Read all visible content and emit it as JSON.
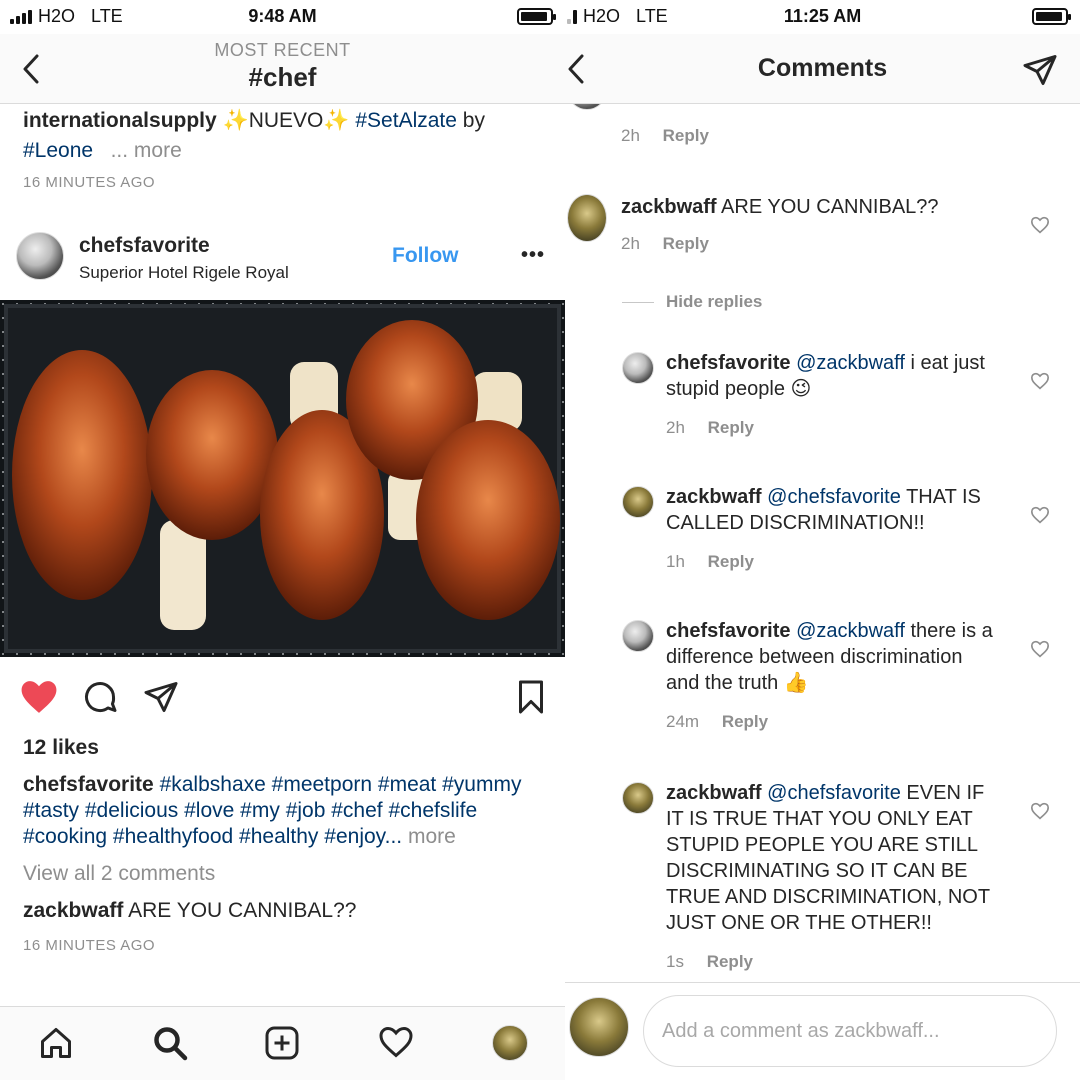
{
  "left": {
    "status": {
      "carrier": "H2O",
      "network": "LTE",
      "time": "9:48 AM"
    },
    "header": {
      "subtitle": "MOST RECENT",
      "title": "#chef"
    },
    "prev_post": {
      "username": "internationalsupply",
      "sparkle": "✨",
      "text1": "NUEVO",
      "tag1": "#SetAlzate",
      "by": "by",
      "tag2": "#Leone",
      "more": "... more",
      "time": "16 MINUTES AGO"
    },
    "post": {
      "username": "chefsfavorite",
      "location": "Superior Hotel Rigele Royal",
      "follow": "Follow",
      "more": "•••",
      "likes": "12 likes",
      "caption_user": "chefsfavorite",
      "hashtags": [
        "#kalbshaxe",
        "#meetporn",
        "#meat",
        "#yummy",
        "#tasty",
        "#delicious",
        "#love",
        "#my",
        "#job",
        "#chef",
        "#chefslife",
        "#cooking",
        "#healthyfood",
        "#healthy"
      ],
      "truncated_tag": "#enjoy...",
      "caption_more": "more",
      "view_all": "View all 2 comments",
      "comment_user": "zackbwaff",
      "comment_text": "ARE YOU CANNIBAL??",
      "time": "16 MINUTES AGO"
    }
  },
  "right": {
    "status": {
      "carrier": "H2O",
      "network": "LTE",
      "time": "11:25 AM"
    },
    "header": {
      "title": "Comments"
    },
    "partial_comment": {
      "time": "2h",
      "reply": "Reply"
    },
    "hide_replies": "Hide replies",
    "comments": [
      {
        "user": "zackbwaff",
        "mention": "",
        "text": "ARE YOU CANNIBAL??",
        "emoji": "",
        "time": "2h",
        "reply": "Reply"
      },
      {
        "user": "chefsfavorite",
        "mention": "@zackbwaff",
        "text": "i eat just stupid people",
        "emoji": "😉",
        "time": "2h",
        "reply": "Reply"
      },
      {
        "user": "zackbwaff",
        "mention": "@chefsfavorite",
        "text": "THAT IS CALLED DISCRIMINATION!!",
        "emoji": "",
        "time": "1h",
        "reply": "Reply"
      },
      {
        "user": "chefsfavorite",
        "mention": "@zackbwaff",
        "text": "there is a difference between discrimination and the truth",
        "emoji": "👍",
        "time": "24m",
        "reply": "Reply"
      },
      {
        "user": "zackbwaff",
        "mention": "@chefsfavorite",
        "text": "EVEN IF IT IS TRUE THAT YOU ONLY EAT STUPID PEOPLE YOU ARE STILL DISCRIMINATING SO IT CAN BE TRUE AND DISCRIMINATION, NOT JUST ONE OR THE OTHER!!",
        "emoji": "",
        "time": "1s",
        "reply": "Reply"
      }
    ],
    "composer": {
      "placeholder": "Add a comment as zackbwaff..."
    }
  },
  "colors": {
    "accent": "#3897f0",
    "hashtag": "#003569",
    "like": "#ed4956",
    "muted": "#8e8e8e"
  },
  "icons": [
    "back-icon",
    "heart-icon",
    "comment-icon",
    "send-icon",
    "bookmark-icon",
    "home-icon",
    "search-icon",
    "add-icon",
    "activity-icon",
    "profile-icon"
  ]
}
